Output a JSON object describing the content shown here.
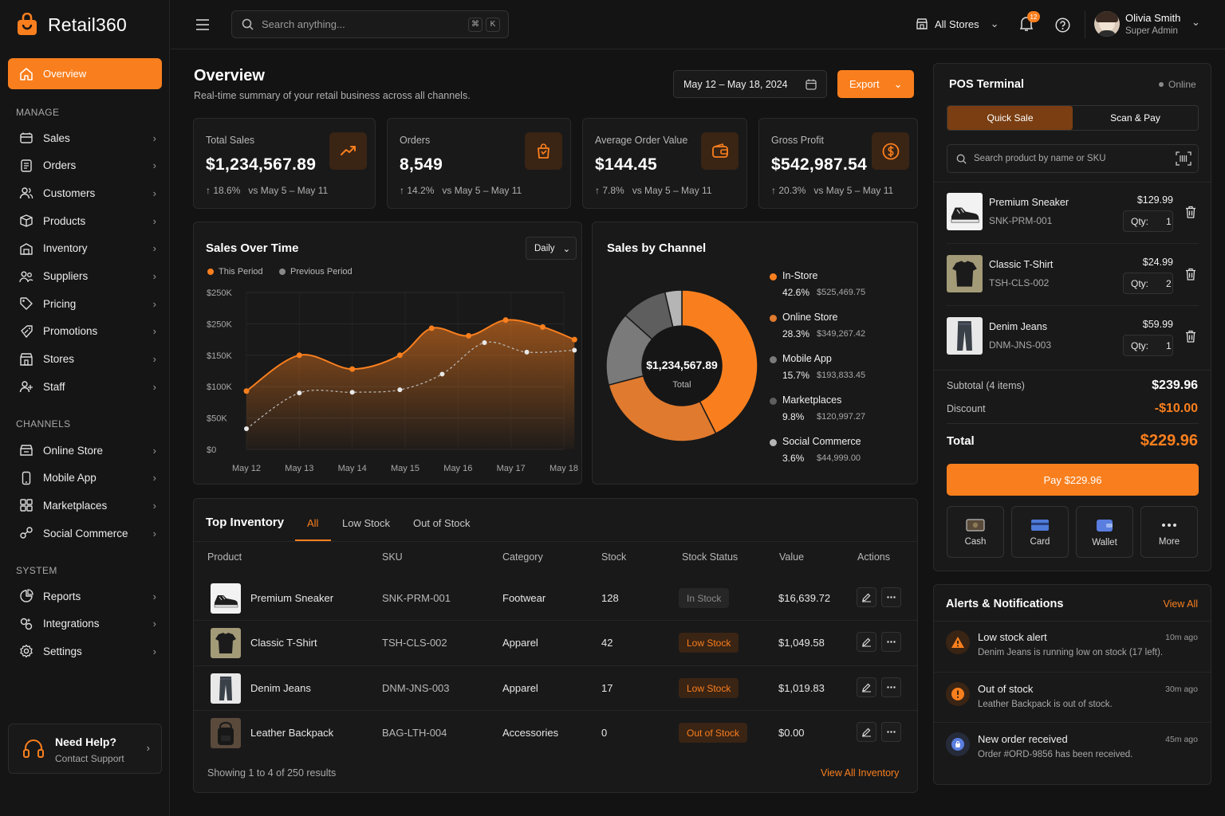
{
  "brand": {
    "name": "Retail360"
  },
  "sidebar": {
    "active": "Overview",
    "sections": {
      "manage": "MANAGE",
      "channels": "CHANNELS",
      "system": "SYSTEM"
    },
    "manage": [
      "Sales",
      "Orders",
      "Customers",
      "Products",
      "Inventory",
      "Suppliers",
      "Pricing",
      "Promotions",
      "Stores",
      "Staff"
    ],
    "channels": [
      "Online Store",
      "Mobile App",
      "Marketplaces",
      "Social Commerce"
    ],
    "system": [
      "Reports",
      "Integrations",
      "Settings"
    ],
    "help": {
      "title": "Need Help?",
      "subtitle": "Contact Support"
    }
  },
  "topbar": {
    "search_placeholder": "Search anything...",
    "shortcut": [
      "⌘",
      "K"
    ],
    "store_selector": "All Stores",
    "notification_count": "12",
    "user": {
      "name": "Olivia Smith",
      "role": "Super Admin"
    }
  },
  "page": {
    "title": "Overview",
    "subtitle": "Real-time summary of your retail business across all channels.",
    "date_range": "May 12 – May 18, 2024",
    "export_label": "Export"
  },
  "stats": [
    {
      "label": "Total Sales",
      "value": "$1,234,567.89",
      "delta": "18.6%",
      "compare": "vs May 5 – May 11",
      "icon": "trend-up-icon"
    },
    {
      "label": "Orders",
      "value": "8,549",
      "delta": "14.2%",
      "compare": "vs May 5 – May 11",
      "icon": "shopping-bag-icon"
    },
    {
      "label": "Average Order Value",
      "value": "$144.45",
      "delta": "7.8%",
      "compare": "vs May 5 – May 11",
      "icon": "wallet-icon"
    },
    {
      "label": "Gross Profit",
      "value": "$542,987.54",
      "delta": "20.3%",
      "compare": "vs May 5 – May 11",
      "icon": "dollar-icon"
    }
  ],
  "sales_chart": {
    "title": "Sales Over Time",
    "period_select": "Daily",
    "legend": [
      "This Period",
      "Previous Period"
    ],
    "y_ticks": [
      "$250K",
      "$250K",
      "$150K",
      "$100K",
      "$50K",
      "$0"
    ]
  },
  "chart_data": [
    {
      "type": "area",
      "title": "Sales Over Time",
      "x": [
        "May 12",
        "May 13",
        "May 14",
        "May 15",
        "May 16",
        "May 17",
        "May 18"
      ],
      "ylim": [
        0,
        250000
      ],
      "grid": true,
      "legend_position": "top-left",
      "series": [
        {
          "name": "This Period",
          "x": [
            0,
            1,
            2,
            2.9,
            3.5,
            4.2,
            4.9,
            5.6,
            6.2
          ],
          "values": [
            93000,
            150000,
            128000,
            150000,
            193000,
            181000,
            206000,
            195000,
            175000
          ],
          "color": "#f97f1e"
        },
        {
          "name": "Previous Period",
          "x": [
            0,
            1,
            2,
            2.9,
            3.7,
            4.5,
            5.3,
            6.2
          ],
          "values": [
            33000,
            90000,
            91000,
            95000,
            120000,
            170000,
            155000,
            158000
          ],
          "color": "#d0d0d0"
        }
      ]
    },
    {
      "type": "pie",
      "title": "Sales by Channel",
      "center_value": "$1,234,567.89",
      "center_label": "Total",
      "slices": [
        {
          "label": "In-Store",
          "percent": 42.6,
          "value": "$525,469.75",
          "color": "#f97f1e"
        },
        {
          "label": "Online Store",
          "percent": 28.3,
          "value": "$349,267.42",
          "color": "#e07a2e"
        },
        {
          "label": "Mobile App",
          "percent": 15.7,
          "value": "$193,833.45",
          "color": "#7a7a7a"
        },
        {
          "label": "Marketplaces",
          "percent": 9.8,
          "value": "$120,997.27",
          "color": "#5e5e5e"
        },
        {
          "label": "Social Commerce",
          "percent": 3.6,
          "value": "$44,999.00",
          "color": "#b5b5b5"
        }
      ]
    }
  ],
  "inventory": {
    "title": "Top Inventory",
    "tabs": [
      "All",
      "Low Stock",
      "Out of Stock"
    ],
    "columns": [
      "Product",
      "SKU",
      "Category",
      "Stock",
      "Stock Status",
      "Value",
      "Actions"
    ],
    "rows": [
      {
        "product": "Premium Sneaker",
        "sku": "SNK-PRM-001",
        "category": "Footwear",
        "stock": "128",
        "status": "In Stock",
        "value": "$16,639.72"
      },
      {
        "product": "Classic T-Shirt",
        "sku": "TSH-CLS-002",
        "category": "Apparel",
        "stock": "42",
        "status": "Low Stock",
        "value": "$1,049.58"
      },
      {
        "product": "Denim Jeans",
        "sku": "DNM-JNS-003",
        "category": "Apparel",
        "stock": "17",
        "status": "Low Stock",
        "value": "$1,019.83"
      },
      {
        "product": "Leather Backpack",
        "sku": "BAG-LTH-004",
        "category": "Accessories",
        "stock": "0",
        "status": "Out of Stock",
        "value": "$0.00"
      }
    ],
    "footer": "Showing 1 to 4 of 250 results",
    "view_all": "View All Inventory"
  },
  "pos": {
    "title": "POS Terminal",
    "status": "Online",
    "tabs": [
      "Quick Sale",
      "Scan & Pay"
    ],
    "search_placeholder": "Search product by name or SKU",
    "qty_label": "Qty:",
    "items": [
      {
        "name": "Premium Sneaker",
        "sku": "SNK-PRM-001",
        "price": "$129.99",
        "qty": "1"
      },
      {
        "name": "Classic T-Shirt",
        "sku": "TSH-CLS-002",
        "price": "$24.99",
        "qty": "2"
      },
      {
        "name": "Denim Jeans",
        "sku": "DNM-JNS-003",
        "price": "$59.99",
        "qty": "1"
      }
    ],
    "subtotal_label": "Subtotal (4 items)",
    "subtotal": "$239.96",
    "discount_label": "Discount",
    "discount": "-$10.00",
    "total_label": "Total",
    "total": "$229.96",
    "pay_label": "Pay $229.96",
    "methods": [
      "Cash",
      "Card",
      "Wallet",
      "More"
    ]
  },
  "alerts": {
    "title": "Alerts & Notifications",
    "view_all": "View All",
    "items": [
      {
        "title": "Low stock alert",
        "message": "Denim Jeans is running low on stock (17 left).",
        "time": "10m ago"
      },
      {
        "title": "Out of stock",
        "message": "Leather Backpack is out of stock.",
        "time": "30m ago"
      },
      {
        "title": "New order received",
        "message": "Order #ORD-9856 has been received.",
        "time": "45m ago"
      }
    ]
  },
  "colors": {
    "accent": "#f97f1e",
    "background": "#131313",
    "card": "#191919",
    "in_stock": "#8a8a8a",
    "low_stock": "#f97f1e",
    "out_of_stock": "#f97f1e"
  }
}
